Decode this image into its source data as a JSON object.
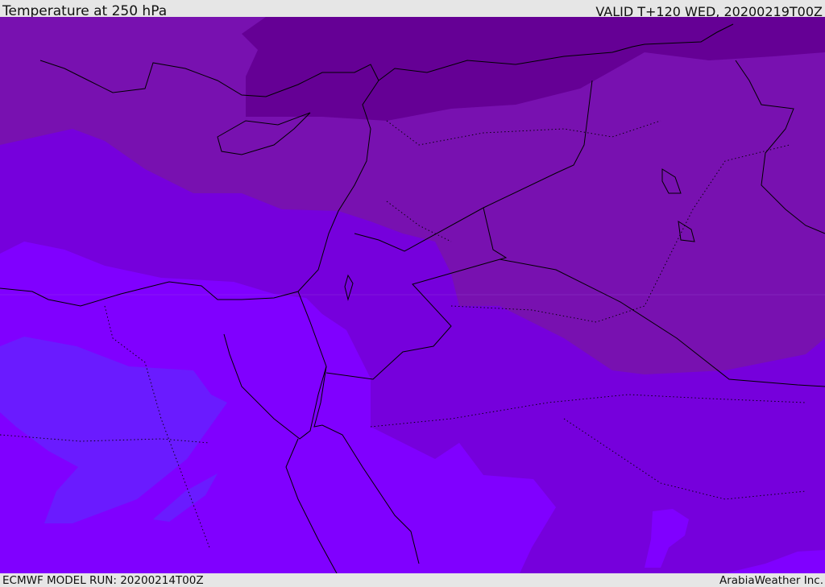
{
  "header": {
    "title": "Temperature at 250 hPa",
    "valid": "VALID T+120 WED, 20200219T00Z"
  },
  "footer": {
    "model_run": "ECMWF MODEL RUN: 20200214T00Z",
    "brand": "ArabiaWeather Inc."
  },
  "colors": {
    "level_darkest": "#650095",
    "level_dark": "#7811b0",
    "level_mid": "#7600dc",
    "level_bright": "#8000ff",
    "level_blue": "#6a1bff",
    "coastline": "#000000"
  }
}
